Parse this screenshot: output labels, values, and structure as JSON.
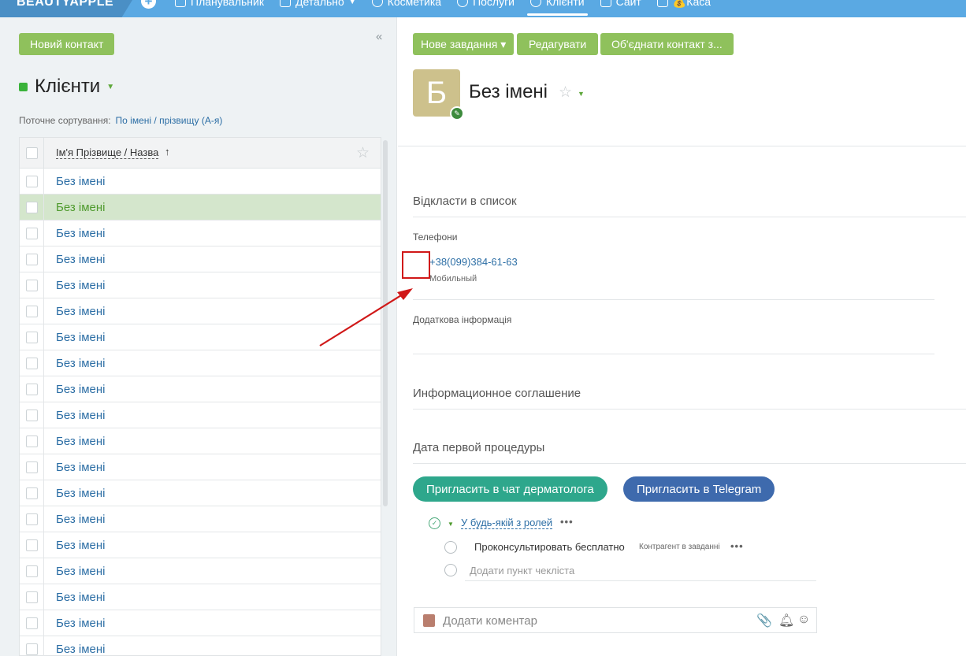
{
  "topbar": {
    "brand": "BEAUTYAPPLE",
    "plus": "+",
    "nav": [
      {
        "label": "Планувальник",
        "icon": "calendar-icon",
        "caret": false,
        "active": false
      },
      {
        "label": "Детально",
        "icon": "chart-icon",
        "caret": true,
        "active": false
      },
      {
        "label": "Косметика",
        "icon": "list-icon",
        "caret": false,
        "active": false
      },
      {
        "label": "Послуги",
        "icon": "list-icon",
        "caret": false,
        "active": false
      },
      {
        "label": "Клієнти",
        "icon": "list-icon",
        "caret": false,
        "active": true
      },
      {
        "label": "Сайт",
        "icon": "tag-icon",
        "caret": false,
        "active": false
      },
      {
        "label": "💰Каса",
        "icon": "bar-chart-icon",
        "caret": false,
        "active": false
      }
    ]
  },
  "left": {
    "new_contact": "Новий контакт",
    "collapse": "«",
    "title": "Клієнти",
    "sort_label": "Поточне сортування:",
    "sort_value": "По імені / прізвищу (А-я)",
    "column": "Ім'я Прізвище / Назва",
    "sort_arrow": "↑",
    "rows": [
      "Без імені",
      "Без імені",
      "Без імені",
      "Без імені",
      "Без імені",
      "Без імені",
      "Без імені",
      "Без імені",
      "Без імені",
      "Без імені",
      "Без імені",
      "Без імені",
      "Без імені",
      "Без імені",
      "Без імені",
      "Без імені",
      "Без імені",
      "Без імені",
      "Без імені"
    ],
    "selected_row": 1
  },
  "right": {
    "buttons": {
      "new_task": "Нове завдання ▾",
      "edit": "Редагувати",
      "merge": "Об'єднати контакт з..."
    },
    "avatar_letter": "Б",
    "contact_name": "Без імені",
    "defer": "Відкласти в список",
    "phones_label": "Телефони",
    "phone": "+38(099)384-61-63",
    "phone_type": "Мобильный",
    "extra_info": "Додаткова інформація",
    "agreement": "Информационное соглашение",
    "first_procedure": "Дата первой процедуры",
    "invite_derm": "Пригласить в чат дерматолога",
    "invite_telegram": "Пригласить в Telegram",
    "checklist": {
      "title": "У будь-якій з ролей",
      "item": "Проконсультировать бесплатно",
      "item_tag": "Контрагент в завданні",
      "add": "Додати пункт чекліста"
    },
    "comment_placeholder": "Додати коментар"
  },
  "colors": {
    "topbar": "#5aa9e3",
    "green_button": "#8fc15c",
    "link": "#2c6ea5",
    "selected_row": "#d4e6cc",
    "teal_pill": "#2ea78c",
    "blue_pill": "#3e6aad",
    "annotation": "#d01818"
  }
}
